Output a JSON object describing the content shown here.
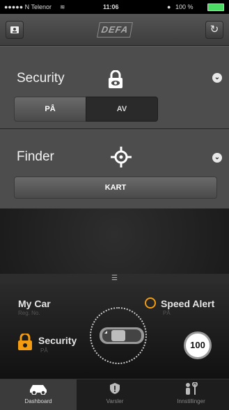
{
  "status_bar": {
    "carrier": "●●●●● N Telenor",
    "wifi": "≋",
    "time": "11:06",
    "alarm": "●",
    "battery": "100 %"
  },
  "top_bar": {
    "logo": "DEFA",
    "left_icon": "id-card-icon",
    "right_icon": "refresh-icon"
  },
  "security_panel": {
    "title": "Security",
    "icon": "lock-eye-icon",
    "toggle_on": "PÅ",
    "toggle_off": "AV",
    "selected": "AV"
  },
  "finder_panel": {
    "title": "Finder",
    "icon": "crosshair-icon",
    "map_button": "KART"
  },
  "car_panel": {
    "my_car": "My Car",
    "my_car_sub": "Reg. No.",
    "speed_alert": "Speed Alert",
    "speed_alert_sub": "PÅ",
    "security": "Security",
    "security_sub": "PÅ",
    "speed_value": "100"
  },
  "tabs": [
    {
      "label": "Dashboard",
      "icon": "car-icon",
      "active": true
    },
    {
      "label": "Varsler",
      "icon": "shield-icon",
      "active": false
    },
    {
      "label": "Innstillinger",
      "icon": "settings-icon",
      "active": false
    }
  ],
  "colors": {
    "accent": "#f39c12",
    "panel": "#4d4d4d",
    "background": "#1a1a1a"
  }
}
